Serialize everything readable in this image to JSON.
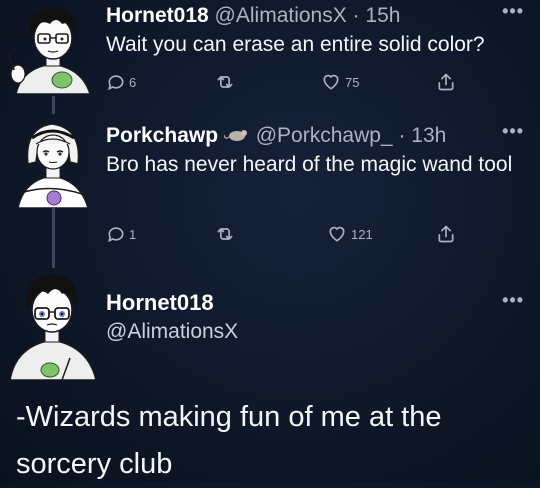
{
  "tweets": [
    {
      "name": "Hornet018",
      "handle": "@AlimationsX",
      "time": "· 15h",
      "text": "Wait you can erase an entire solid color?",
      "replies": "6",
      "retweets": "",
      "likes": "75"
    },
    {
      "name": "Porkchawp",
      "handle": "@Porkchawp_",
      "time": "· 13h",
      "text": "Bro has never heard of the magic wand tool",
      "replies": "1",
      "retweets": "",
      "likes": "121"
    }
  ],
  "main": {
    "name": "Hornet018",
    "handle": "@AlimationsX",
    "text": "-Wizards making fun of me at the sorcery club"
  },
  "more_label": "•••",
  "icons": {
    "reply": "speech-bubble-icon",
    "retweet": "retweet-icon",
    "like": "heart-icon",
    "share": "share-icon",
    "badge": "rat-emoji-icon"
  },
  "colors": {
    "background": "#0f1829",
    "text": "#f4f6fa",
    "secondary": "#a9b3c4",
    "thread_line": "#3a4660"
  }
}
